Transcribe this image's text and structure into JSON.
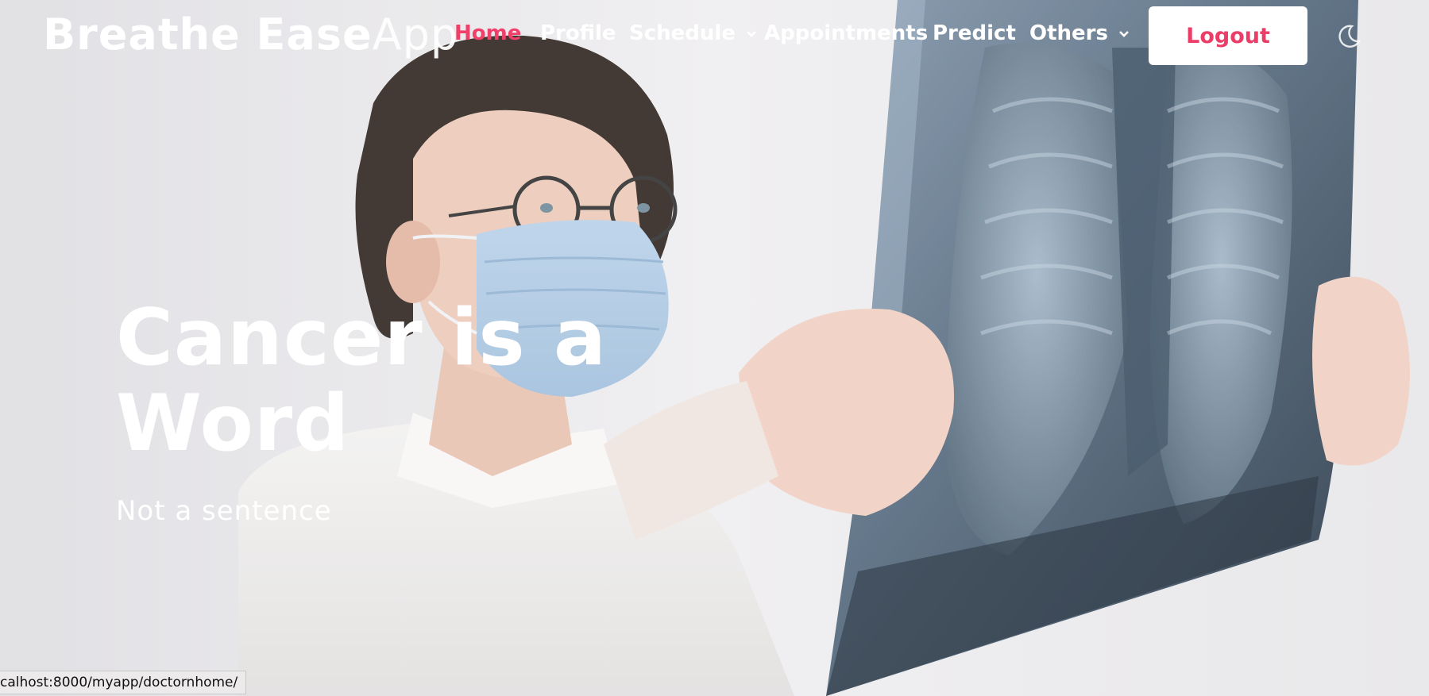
{
  "brand": {
    "bold": "Breathe Ease",
    "light": "App"
  },
  "nav": {
    "items": [
      {
        "label": "Home",
        "active": true
      },
      {
        "label": "Profile"
      },
      {
        "label": "Schedule",
        "dropdown": true
      },
      {
        "label": "Appointments"
      },
      {
        "label": "Predict"
      },
      {
        "label": "Others",
        "dropdown": true
      }
    ],
    "logout_label": "Logout",
    "theme_icon": "moon-icon"
  },
  "hero": {
    "title_line1": "Cancer is a",
    "title_line2": "Word",
    "subtitle": "Not a sentence"
  },
  "status_bar": {
    "url": "calhost:8000/myapp/doctornhome/"
  },
  "colors": {
    "accent": "#ec3c68",
    "nav_text": "#ffffff",
    "background": "#e9e8ea"
  }
}
